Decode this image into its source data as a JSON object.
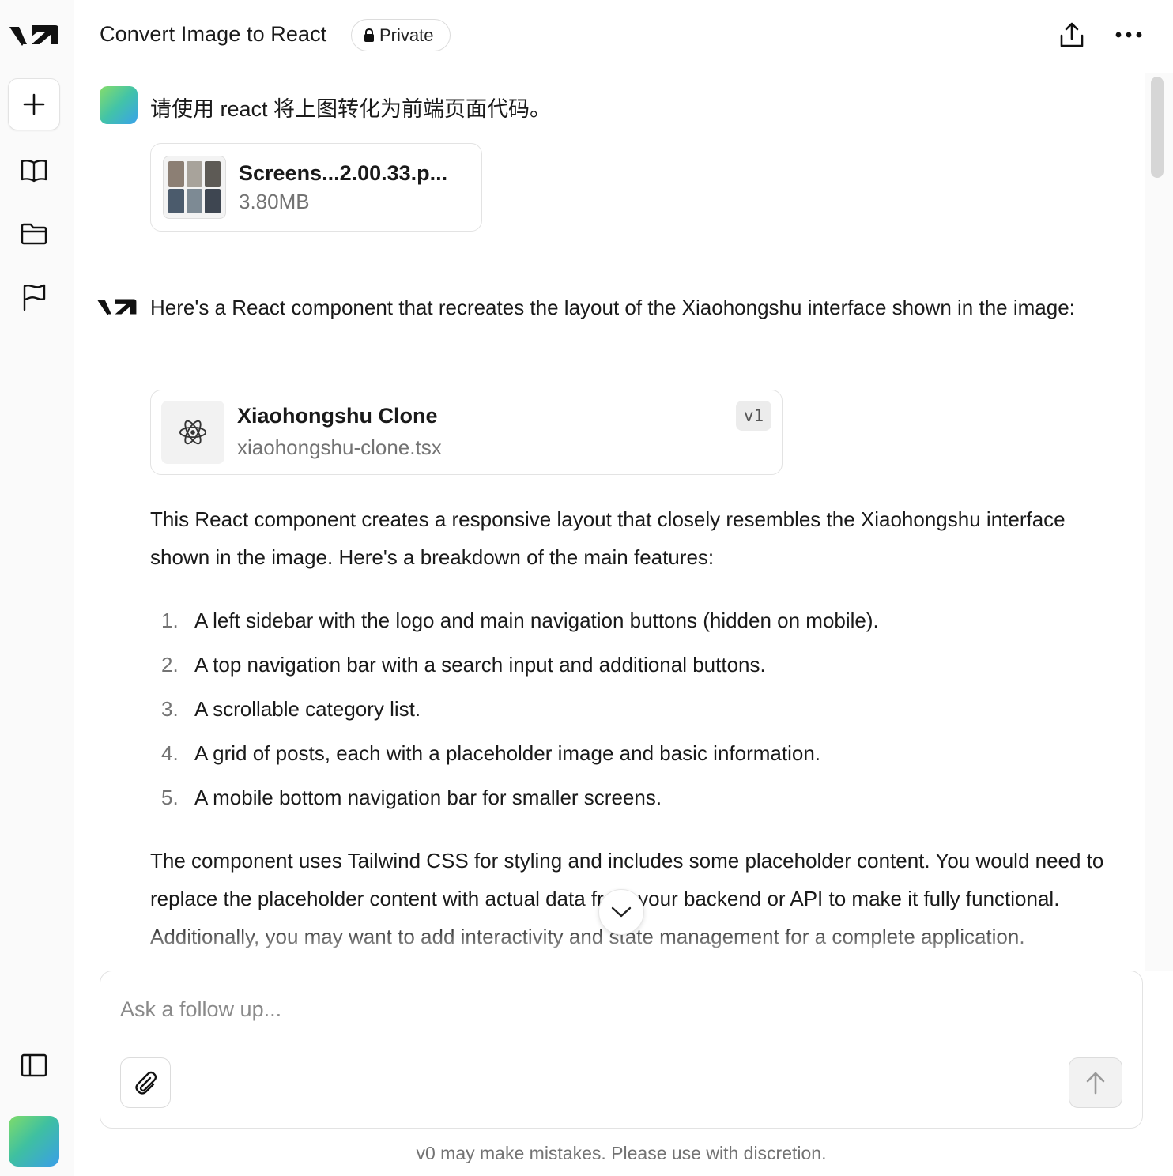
{
  "header": {
    "title": "Convert Image to React",
    "visibility_badge": "Private"
  },
  "sidebar": {
    "items": [
      {
        "name": "new-chat",
        "icon": "plus-icon"
      },
      {
        "name": "library",
        "icon": "book-open-icon"
      },
      {
        "name": "projects",
        "icon": "folder-icon"
      },
      {
        "name": "feedback",
        "icon": "flag-icon"
      },
      {
        "name": "toggle-sidebar",
        "icon": "sidebar-panel-icon"
      }
    ]
  },
  "conversation": {
    "user_message": "请使用 react 将上图转化为前端页面代码。",
    "attachment": {
      "name": "Screens...2.00.33.p...",
      "size": "3.80MB"
    },
    "assistant_intro": "Here's a React component that recreates the layout of the Xiaohongshu interface shown in the image:",
    "code_block": {
      "title": "Xiaohongshu Clone",
      "filename": "xiaohongshu-clone.tsx",
      "version": "v1"
    },
    "summary": "This React component creates a responsive layout that closely resembles the Xiaohongshu interface shown in the image. Here's a breakdown of the main features:",
    "features": [
      {
        "num": "1.",
        "text": "A left sidebar with the logo and main navigation buttons (hidden on mobile)."
      },
      {
        "num": "2.",
        "text": "A top navigation bar with a search input and additional buttons."
      },
      {
        "num": "3.",
        "text": "A scrollable category list."
      },
      {
        "num": "4.",
        "text": "A grid of posts, each with a placeholder image and basic information."
      },
      {
        "num": "5.",
        "text": "A mobile bottom navigation bar for smaller screens."
      }
    ],
    "closing": "The component uses Tailwind CSS for styling and includes some placeholder content. You would need to replace the placeholder content with actual data from your backend or API to make it fully functional. Additionally, you may want to add interactivity and state management for a complete application."
  },
  "composer": {
    "placeholder": "Ask a follow up...",
    "value": ""
  },
  "footer": {
    "disclaimer": "v0 may make mistakes. Please use with discretion."
  },
  "colors": {
    "text": "#171717",
    "muted": "#737373",
    "border": "#e3e3e3",
    "avatar_gradient_start": "#7fdc6a",
    "avatar_gradient_end": "#3a9ee8"
  }
}
